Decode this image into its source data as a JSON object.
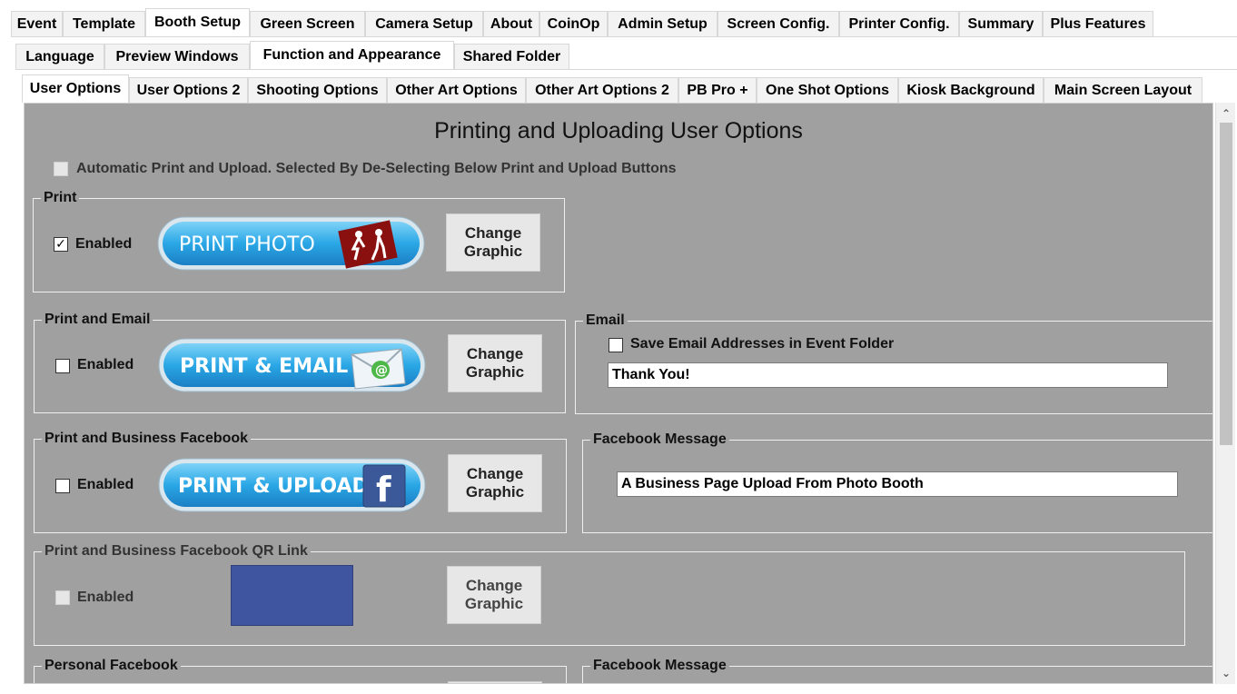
{
  "tabs_row1": [
    "Event",
    "Template",
    "Booth Setup",
    "Green Screen",
    "Camera Setup",
    "About",
    "CoinOp",
    "Admin Setup",
    "Screen Config.",
    "Printer Config.",
    "Summary",
    "Plus Features"
  ],
  "tabs_row2": [
    "Language",
    "Preview Windows",
    "Function and Appearance",
    "Shared Folder"
  ],
  "tabs_row3": [
    "User Options",
    "User Options 2",
    "Shooting Options",
    "Other Art Options",
    "Other Art Options 2",
    "PB Pro +",
    "One Shot Options",
    "Kiosk Background",
    "Main Screen Layout"
  ],
  "panel": {
    "title": "Printing and Uploading User Options",
    "auto_label": "Automatic Print and Upload. Selected By De-Selecting Below Print and Upload Buttons",
    "auto_checked": false,
    "enabled_label": "Enabled",
    "change_line1": "Change",
    "change_line2": "Graphic",
    "checkmark": "✓",
    "print": {
      "legend": "Print",
      "checked": true,
      "button_text": "PRINT PHOTO"
    },
    "print_email": {
      "legend": "Print and Email",
      "checked": false,
      "button_text": "PRINT & EMAIL"
    },
    "email": {
      "legend": "Email",
      "save_label": "Save Email Addresses in Event Folder",
      "save_checked": false,
      "message": "Thank You!"
    },
    "print_fb": {
      "legend": "Print and Business Facebook",
      "checked": false,
      "button_text": "PRINT & UPLOAD"
    },
    "fb_message": {
      "legend": "Facebook Message",
      "message": "A Business Page Upload From Photo Booth"
    },
    "print_fb_qr": {
      "legend": "Print and Business Facebook QR Link",
      "checked": false
    },
    "personal_fb": {
      "legend": "Personal Facebook"
    },
    "fb_message2": {
      "legend": "Facebook Message"
    }
  },
  "colors": {
    "panel_bg": "#a0a0a0",
    "button_blue": "#2aa7e6",
    "facebook_blue": "#3f55a0"
  },
  "icons": {
    "scroll_up": "scroll-up-icon",
    "scroll_down": "scroll-down-icon",
    "print_photo_art": "dancers-icon",
    "email_art": "envelope-icon",
    "facebook_art": "facebook-icon"
  },
  "scroll": {
    "up": "⌃",
    "down": "⌄"
  }
}
